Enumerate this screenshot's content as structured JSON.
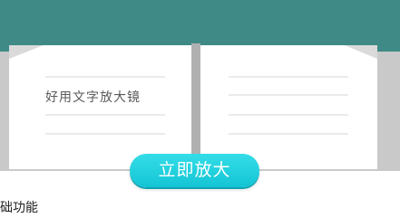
{
  "colors": {
    "header_band": "#3f8a87",
    "page_white": "#ffffff",
    "book_gray": "#c7c7c7",
    "button_cyan": "#1fd0de",
    "button_text": "#ffffff"
  },
  "banner": {
    "book_text": "好用文字放大镜",
    "icon_name": "open-book-icon"
  },
  "actions": {
    "zoom_label": "立即放大"
  },
  "section": {
    "label": "础功能"
  }
}
